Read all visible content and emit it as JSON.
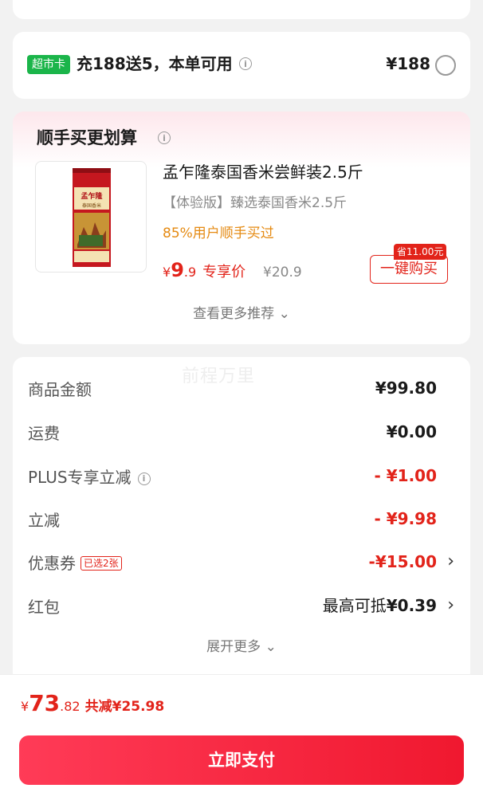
{
  "market_card": {
    "badge": "超市卡",
    "text": "充188送5，本单可用",
    "price": "¥188"
  },
  "bundle": {
    "title": "顺手买更划算",
    "product": {
      "name": "孟乍隆泰国香米尝鲜装2.5斤",
      "subtitle": "【体验版】臻选泰国香米2.5斤",
      "hint": "85%用户顺手买过",
      "price_symbol": "¥",
      "price_int": "9",
      "price_dec": ".9",
      "price_tag": "专享价",
      "original_price": "¥20.9",
      "save_tag": "省11.00元",
      "buy_label": "一键购买",
      "package_brand": "孟乍隆",
      "package_sub": "泰国香米"
    },
    "more_label": "查看更多推荐"
  },
  "summary": {
    "watermark": "前程万里",
    "rows": [
      {
        "label": "商品金额",
        "value": "¥99.80"
      },
      {
        "label": "运费",
        "value": "¥0.00"
      },
      {
        "label": "PLUS专享立减",
        "value": "- ¥1.00"
      },
      {
        "label": "立减",
        "value": "- ¥9.98"
      },
      {
        "label": "优惠券",
        "tag": "已选2张",
        "value": "-¥15.00"
      },
      {
        "label": "红包",
        "value_prefix": "最高可抵",
        "value": "¥0.39"
      }
    ],
    "expand_label": "展开更多"
  },
  "paybar": {
    "symbol": "¥",
    "total_int": "73",
    "total_dec": ".82",
    "saved": "共减¥25.98",
    "pay_label": "立即支付"
  },
  "icons": {
    "info": "i",
    "chevron_right": "›",
    "chevron_down": "⌄"
  }
}
